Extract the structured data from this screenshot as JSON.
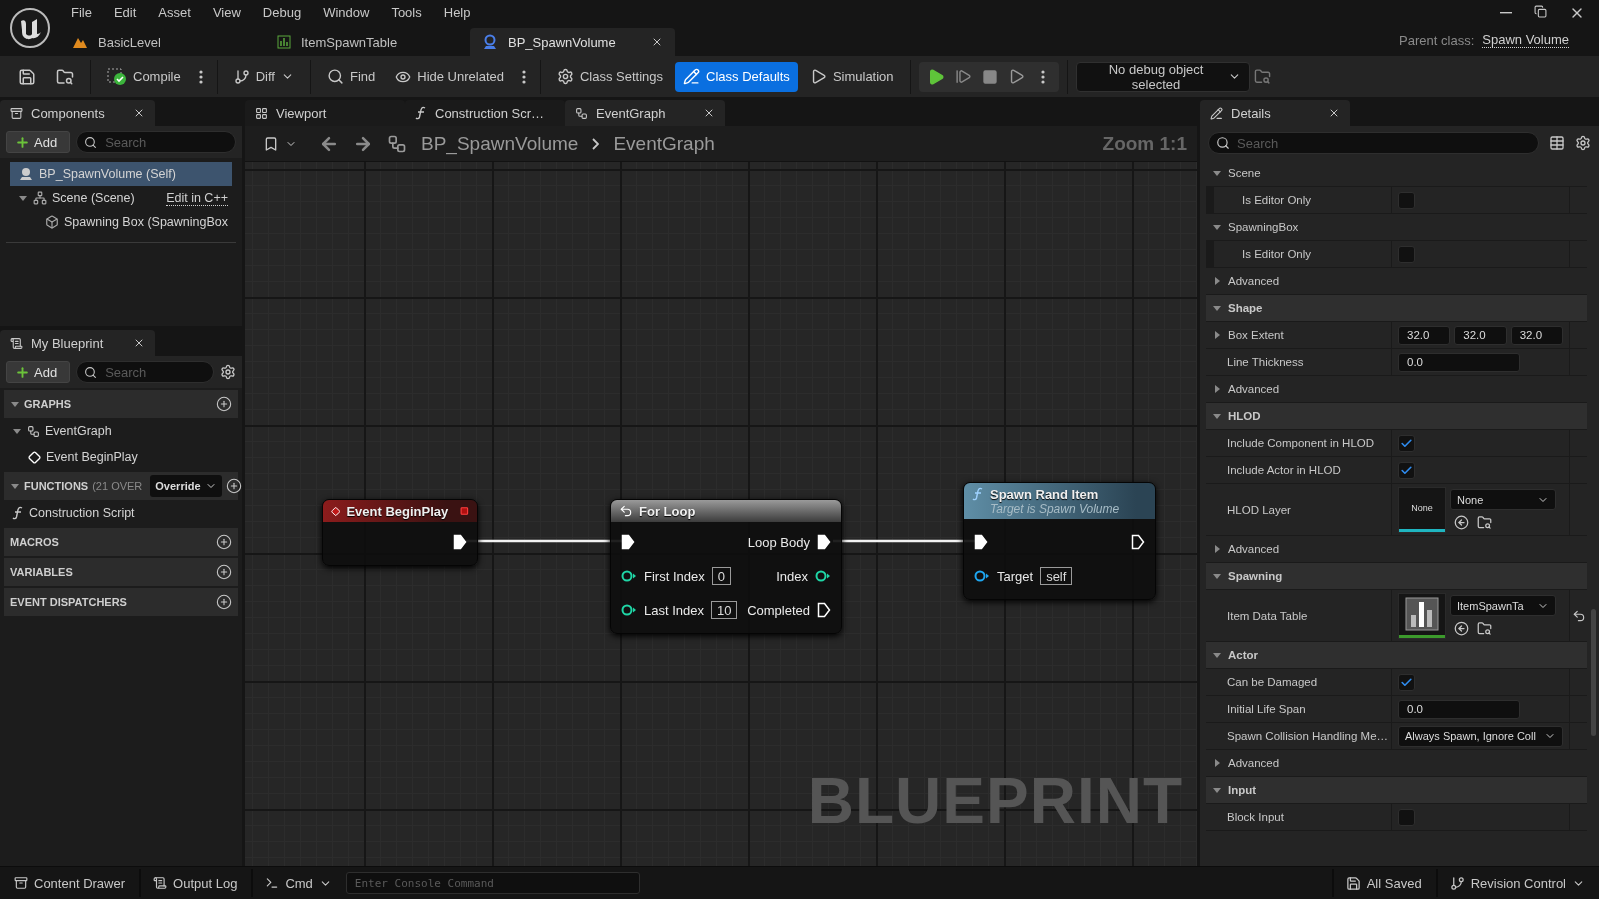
{
  "menu": [
    "File",
    "Edit",
    "Asset",
    "View",
    "Debug",
    "Window",
    "Tools",
    "Help"
  ],
  "doc_tabs": [
    {
      "label": "BasicLevel",
      "selected": false
    },
    {
      "label": "ItemSpawnTable",
      "selected": false
    },
    {
      "label": "BP_SpawnVolume",
      "selected": true
    }
  ],
  "parent_class": {
    "label": "Parent class:",
    "value": "Spawn Volume"
  },
  "toolbar": {
    "compile": "Compile",
    "diff": "Diff",
    "find": "Find",
    "hide_unrelated": "Hide Unrelated",
    "class_settings": "Class Settings",
    "class_defaults": {
      "label": "Class Defaults",
      "selected": true
    },
    "simulation": "Simulation",
    "debug_object": "No debug object selected"
  },
  "components": {
    "tab": "Components",
    "add": "Add",
    "search_placeholder": "Search",
    "tree": [
      {
        "label": "BP_SpawnVolume (Self)",
        "selected": true
      },
      {
        "label": "Scene (Scene)",
        "selected": false,
        "expanded": true,
        "link": "Edit in C++",
        "children": [
          {
            "label": "Spawning Box (SpawningBox",
            "selected": false
          }
        ]
      }
    ]
  },
  "my_blueprint": {
    "tab": "My Blueprint",
    "add": "Add",
    "search_placeholder": "Search",
    "sections": [
      {
        "title": "GRAPHS",
        "expanded": true,
        "items": [
          {
            "label": "EventGraph",
            "expanded": true,
            "children": [
              {
                "label": "Event BeginPlay"
              }
            ]
          }
        ]
      },
      {
        "title": "FUNCTIONS",
        "note": "(21 OVER",
        "dropdown": "Override",
        "expanded": true,
        "items": [
          {
            "label": "Construction Script"
          }
        ]
      },
      {
        "title": "MACROS"
      },
      {
        "title": "VARIABLES"
      },
      {
        "title": "EVENT DISPATCHERS"
      }
    ]
  },
  "graph_tabs": [
    {
      "label": "Viewport",
      "selected": false
    },
    {
      "label": "Construction Scr…",
      "selected": false
    },
    {
      "label": "EventGraph",
      "selected": true
    }
  ],
  "breadcrumb": [
    "BP_SpawnVolume",
    "EventGraph"
  ],
  "zoom": "Zoom 1:1",
  "watermark": "BLUEPRINT",
  "nodes": [
    {
      "kind": "event",
      "title": "Event BeginPlay",
      "outputs": [
        {
          "kind": "exec",
          "connected": true
        }
      ]
    },
    {
      "kind": "macro",
      "title": "For Loop",
      "inputs": [
        {
          "kind": "exec",
          "connected": true
        },
        {
          "kind": "int",
          "label": "First Index",
          "value": "0",
          "connected": false
        },
        {
          "kind": "int",
          "label": "Last Index",
          "value": "10",
          "connected": false
        }
      ],
      "outputs": [
        {
          "kind": "exec",
          "label": "Loop Body",
          "connected": true
        },
        {
          "kind": "int",
          "label": "Index",
          "connected": false
        },
        {
          "kind": "exec",
          "label": "Completed",
          "connected": false
        }
      ]
    },
    {
      "kind": "function",
      "title": "Spawn Rand Item",
      "subtitle": "Target is Spawn Volume",
      "inputs": [
        {
          "kind": "exec",
          "connected": true
        },
        {
          "kind": "object",
          "label": "Target",
          "value": "self",
          "connected": false
        }
      ],
      "outputs": [
        {
          "kind": "exec",
          "connected": false
        }
      ]
    }
  ],
  "details": {
    "tab": "Details",
    "search_placeholder": "Search",
    "rows": [
      {
        "kind": "group",
        "label": "Scene",
        "expanded": true,
        "children": [
          {
            "kind": "checkbox",
            "label": "Is Editor Only",
            "checked": false
          }
        ]
      },
      {
        "kind": "group",
        "label": "SpawningBox",
        "expanded": true,
        "children": [
          {
            "kind": "checkbox",
            "label": "Is Editor Only",
            "checked": false
          }
        ]
      },
      {
        "kind": "group",
        "label": "Advanced",
        "expanded": false
      },
      {
        "kind": "section",
        "label": "Shape",
        "expanded": true
      },
      {
        "kind": "vector",
        "label": "Box Extent",
        "expanded": false,
        "values": [
          "32.0",
          "32.0",
          "32.0"
        ]
      },
      {
        "kind": "number",
        "label": "Line Thickness",
        "value": "0.0"
      },
      {
        "kind": "group",
        "label": "Advanced",
        "expanded": false
      },
      {
        "kind": "section",
        "label": "HLOD",
        "expanded": true
      },
      {
        "kind": "checkbox",
        "label": "Include Component in HLOD",
        "checked": true
      },
      {
        "kind": "checkbox",
        "label": "Include Actor in HLOD",
        "checked": true
      },
      {
        "kind": "asset",
        "label": "HLOD Layer",
        "thumbnail": "None",
        "value": "None",
        "color": "#1fb5c0"
      },
      {
        "kind": "group",
        "label": "Advanced",
        "expanded": false
      },
      {
        "kind": "section",
        "label": "Spawning",
        "expanded": true
      },
      {
        "kind": "asset",
        "label": "Item Data Table",
        "value": "ItemSpawnTa",
        "color": "#3c9a2c",
        "reset": true
      },
      {
        "kind": "section",
        "label": "Actor",
        "expanded": true
      },
      {
        "kind": "checkbox",
        "label": "Can be Damaged",
        "checked": true
      },
      {
        "kind": "number",
        "label": "Initial Life Span",
        "value": "0.0"
      },
      {
        "kind": "dropdown",
        "label": "Spawn Collision Handling Me…",
        "value": "Always Spawn, Ignore Coll"
      },
      {
        "kind": "group",
        "label": "Advanced",
        "expanded": false
      },
      {
        "kind": "section",
        "label": "Input",
        "expanded": true
      },
      {
        "kind": "checkbox",
        "label": "Block Input",
        "checked": false
      }
    ]
  },
  "status_bar": {
    "content_drawer": "Content Drawer",
    "output_log": "Output Log",
    "cmd": "Cmd",
    "console_placeholder": "Enter Console Command",
    "saved": "All Saved",
    "revision": "Revision Control"
  }
}
